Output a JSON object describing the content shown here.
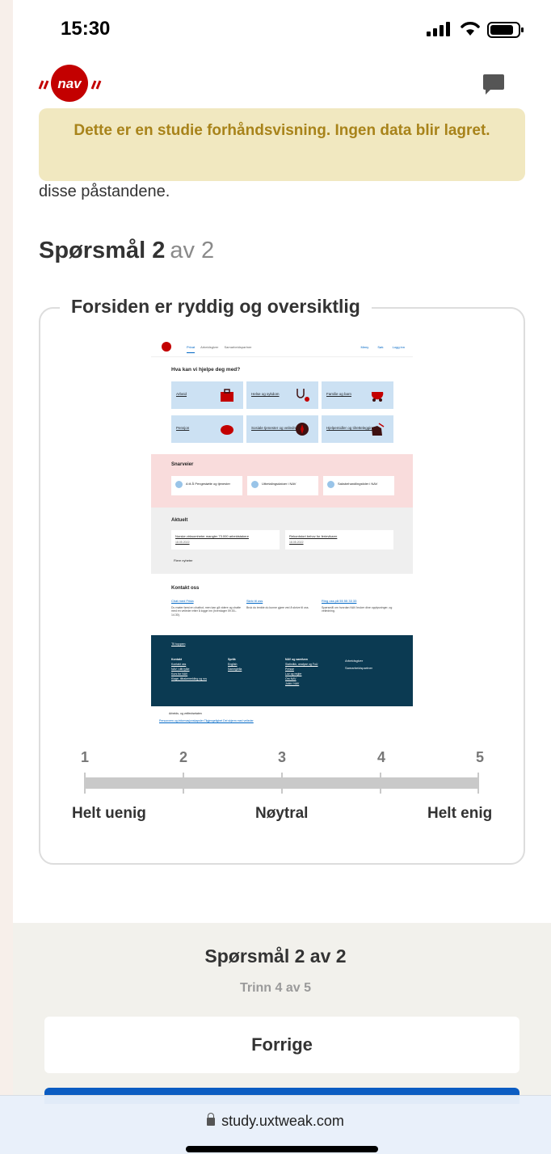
{
  "status": {
    "time": "15:30"
  },
  "banner": {
    "text": "Dette er en studie forhåndsvisning. Ingen data blir lagret."
  },
  "intro_fragment": "disse påstandene.",
  "question": {
    "label": "Spørsmål 2",
    "of": "av 2"
  },
  "statement": "Forsiden er ryddig og oversiktlig",
  "screenshot": {
    "tabs": [
      "Privat",
      "Arbeidsgiver",
      "Samarbeidspartner"
    ],
    "right_links": [
      "Meny",
      "Søk",
      "Logg inn"
    ],
    "heading": "Hva kan vi hjelpe deg med?",
    "tiles": [
      "Arbeid",
      "Helse og sykdom",
      "Familie og barn",
      "Pensjon",
      "Sosiale tjenester og veiledning",
      "Hjelpemidler og tilrettelegging"
    ],
    "snarveier_title": "Snarveier",
    "snarveier": [
      "A til Å Pengestøtte og tjenester",
      "Utbetalingsdatoer i NAV",
      "Saksbehandlingstider i NAV"
    ],
    "aktuelt_title": "Aktuelt",
    "news": [
      {
        "title": "Norske virksomheter mangler 73.000 arbeidstakere",
        "date": "18.05.2022"
      },
      {
        "title": "Rekordstort behov for ferievikarer",
        "date": "18.05.2022"
      }
    ],
    "more_news": "Flere nyheter",
    "kontakt_title": "Kontakt oss",
    "contacts": [
      {
        "title": "Chat med Frida",
        "text": "Du møter først en chatbot, men kan gå videre og chatte med en veileder etter å logge inn (hverdager 09.00–14.30)."
      },
      {
        "title": "Skriv til oss",
        "text": "Bruk du tenkte du kunne gjøre ved å skrive til oss."
      },
      {
        "title": "Ring oss på 55 55 33 33",
        "text": "Spørsmål om hvordan NAV bruker dine opplysninger, og veiledning."
      }
    ],
    "to_top": "Til toppen",
    "footer_cols": [
      {
        "head": "Kontakt",
        "items": [
          "Kontakt oss",
          "NAV i ditt fylke",
          "Kurs for NAV",
          "Klage, tilbakemelding og ros"
        ]
      },
      {
        "head": "Språk",
        "items": [
          "English",
          "Samegiella"
        ]
      },
      {
        "head": "NAV og samfunn",
        "items": [
          "Statistikk, analyse og FoU",
          "Presse",
          "Lov og regler",
          "Om NAV",
          "Jobb i NAV"
        ]
      },
      {
        "head": "",
        "items": [
          "Arbeidsgiver",
          "Samarbeidspartner"
        ]
      }
    ],
    "bottom_org": "Arbeids- og velferdsetaten",
    "bottom_links": "Personvern og informasjonskapsler   Tilgjengelighet   Del skjerm med veileder"
  },
  "scale": {
    "numbers": [
      "1",
      "2",
      "3",
      "4",
      "5"
    ],
    "label_left": "Helt uenig",
    "label_mid": "Nøytral",
    "label_right": "Helt enig"
  },
  "footer": {
    "question_of": "Spørsmål 2 av 2",
    "step": "Trinn 4 av 5",
    "prev": "Forrige"
  },
  "browser": {
    "url": "study.uxtweak.com"
  },
  "colors": {
    "nav_red": "#c30000",
    "banner_bg": "#f1e8c0",
    "banner_text": "#a8831a",
    "primary_blue": "#0b5cc2"
  }
}
